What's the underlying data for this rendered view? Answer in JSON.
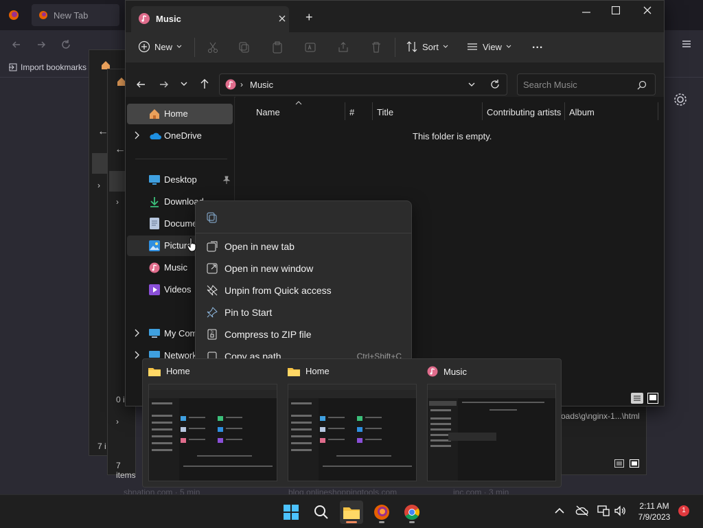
{
  "browser": {
    "tab_title": "New Tab",
    "bookmarks_label": "Import bookmarks",
    "shortcuts": [
      "sbnation.com · 5 min",
      "blog.onlineshoppingtools.com",
      "inc.com · 3 min"
    ],
    "path_text": "oads\\g\\nginx-1...\\html"
  },
  "bg_windows": {
    "status_a": "7 i",
    "status_b": "0 i",
    "status_c": "7 items"
  },
  "explorer": {
    "tab_title": "Music",
    "new_tab_label": "+",
    "toolbar": {
      "new_label": "New",
      "sort_label": "Sort",
      "view_label": "View",
      "more_label": "..."
    },
    "address": {
      "path": "Music"
    },
    "search": {
      "placeholder": "Search Music"
    },
    "nav": {
      "home": "Home",
      "onedrive": "OneDrive",
      "desktop": "Desktop",
      "downloads": "Download",
      "documents": "Docume",
      "pictures": "Picture",
      "music": "Music",
      "videos": "Videos",
      "computer": "My Comp",
      "network": "Network"
    },
    "columns": [
      "Name",
      "#",
      "Title",
      "Contributing artists",
      "Album"
    ],
    "empty_message": "This folder is empty."
  },
  "context_menu": {
    "items": [
      {
        "label": "Open in new tab",
        "shortcut": ""
      },
      {
        "label": "Open in new window",
        "shortcut": ""
      },
      {
        "label": "Unpin from Quick access",
        "shortcut": ""
      },
      {
        "label": "Pin to Start",
        "shortcut": ""
      },
      {
        "label": "Compress to ZIP file",
        "shortcut": ""
      },
      {
        "label": "Copy as path",
        "shortcut": "Ctrl+Shift+C"
      }
    ]
  },
  "previews": [
    {
      "title": "Home"
    },
    {
      "title": "Home"
    },
    {
      "title": "Music"
    }
  ],
  "taskbar": {
    "time": "2:11 AM",
    "date": "7/9/2023",
    "notification_count": "1"
  },
  "colors": {
    "accent": "#0078d4",
    "folder_yellow": "#f5c244",
    "music_pink": "#e06c8c",
    "badge_red": "#e0393e"
  }
}
